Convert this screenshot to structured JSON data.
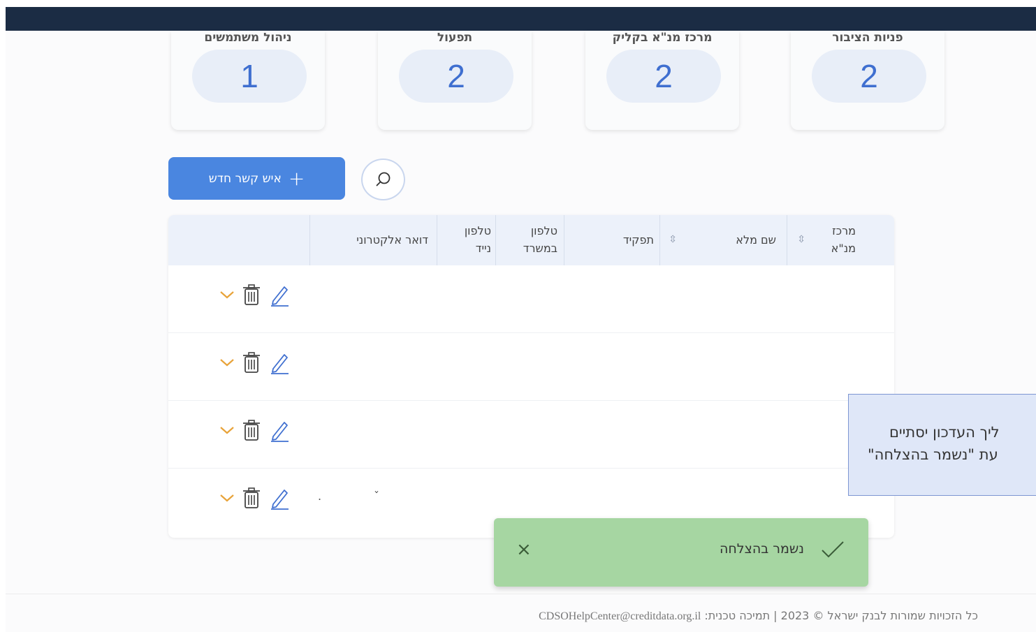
{
  "stats": [
    {
      "label": "פניות הציבור",
      "value": "2"
    },
    {
      "label": "מרכז מנ\"א בקליק",
      "value": "2"
    },
    {
      "label": "תפעול",
      "value": "2"
    },
    {
      "label": "ניהול משתמשים",
      "value": "1"
    }
  ],
  "toolbar": {
    "add_contact_label": "איש קשר חדש",
    "add_icon": "+",
    "search_icon": "search-icon"
  },
  "table": {
    "headers": {
      "center_line1": "מרכז",
      "center_line2": "מנ\"א",
      "full_name": "שם מלא",
      "role": "תפקיד",
      "office_phone_line1": "טלפון",
      "office_phone_line2": "במשרד",
      "mobile_line1": "טלפון",
      "mobile_line2": "נייד",
      "email": "דואר אלקטרוני"
    },
    "rows": [
      {},
      {},
      {},
      {}
    ]
  },
  "toast": {
    "message": "נשמר בהצלחה",
    "close_icon": "×",
    "color": "#a6d6a2"
  },
  "tooltip": {
    "line1": "ליך העדכון יסתיים",
    "line2": "עת \"נשמר בהצלחה\""
  },
  "footer": {
    "copyright": "כל הזכויות שמורות לבנק ישראל © 2023 | תמיכה טכנית:",
    "email": "CDSOHelpCenter@creditdata.org.il"
  },
  "colors": {
    "topbar": "#1b2c44",
    "accent": "#4a86e0",
    "stat_number": "#3f6fd0"
  }
}
